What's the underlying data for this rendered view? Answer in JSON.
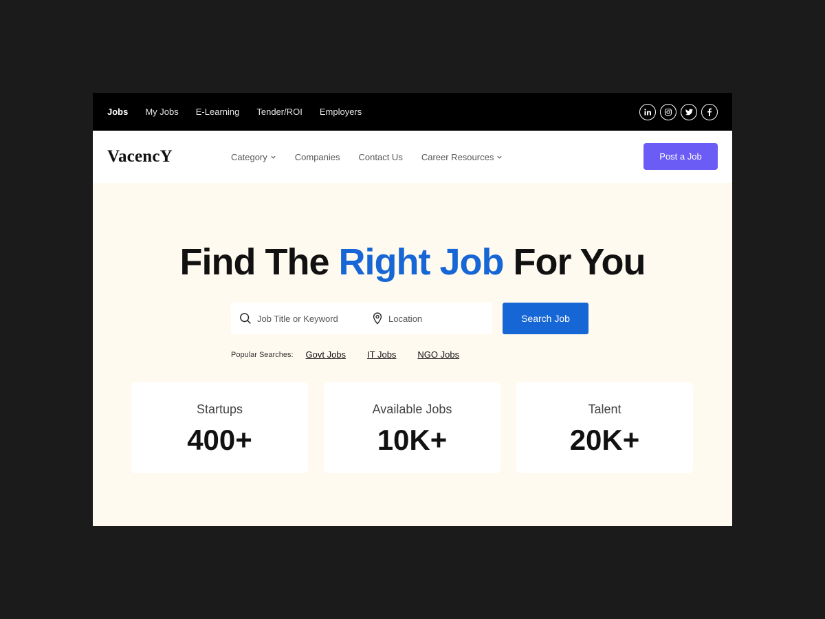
{
  "topbar": {
    "links": [
      "Jobs",
      "My Jobs",
      "E-Learning",
      "Tender/ROI",
      "Employers"
    ],
    "active": "Jobs",
    "socials": [
      "linkedin-icon",
      "instagram-icon",
      "twitter-icon",
      "facebook-icon"
    ]
  },
  "header": {
    "logo": "VacencY",
    "nav": [
      "Category",
      "Companies",
      "Contact Us",
      "Career Resources"
    ],
    "post_job": "Post a Job"
  },
  "hero": {
    "title_pre": "Find The ",
    "title_accent": "Right Job",
    "title_post": " For You",
    "accent_color": "#1766d6"
  },
  "search": {
    "keyword_placeholder": "Job Title or Keyword",
    "location_placeholder": "Location",
    "button": "Search Job"
  },
  "popular": {
    "label": "Popular Searches:",
    "links": [
      "Govt Jobs",
      "IT Jobs",
      "NGO Jobs"
    ]
  },
  "stats": [
    {
      "label": "Startups",
      "value": "400+"
    },
    {
      "label": "Available Jobs",
      "value": "10K+"
    },
    {
      "label": "Talent",
      "value": "20K+"
    }
  ],
  "colors": {
    "brand_purple": "#6b5cf5",
    "brand_blue": "#1766d6",
    "hero_bg": "#fffaef",
    "topbar_bg": "#000000"
  }
}
